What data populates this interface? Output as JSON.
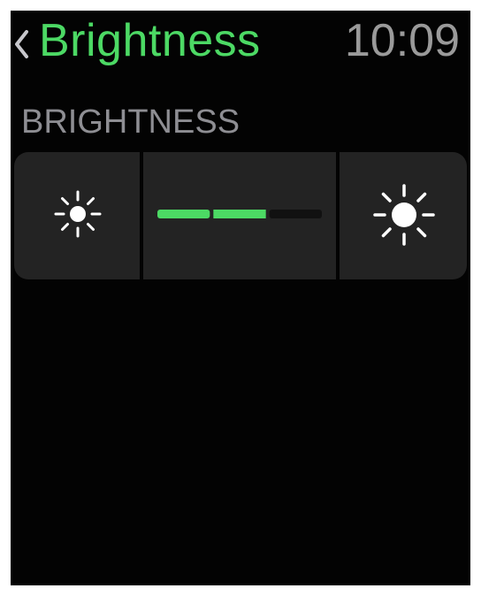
{
  "header": {
    "back_icon": "chevron-left-icon",
    "title": "Brightness",
    "time": "10:09"
  },
  "section": {
    "header": "BRIGHTNESS"
  },
  "brightness_control": {
    "decrease_icon": "sun-small-icon",
    "increase_icon": "sun-large-icon",
    "level": 2,
    "max_level": 3
  },
  "colors": {
    "accent": "#4cd964",
    "background": "#030303",
    "control_bg": "#232323",
    "track_off": "#111111",
    "secondary_text": "#8e8e93"
  }
}
